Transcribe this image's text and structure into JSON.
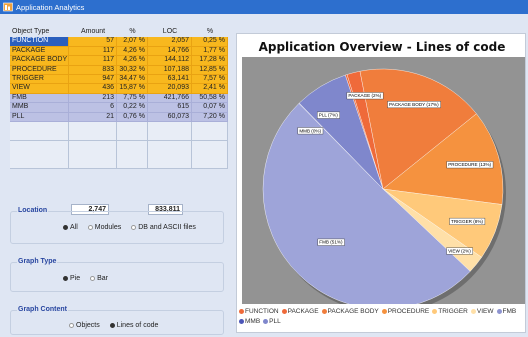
{
  "window": {
    "title": "Application Analytics"
  },
  "table": {
    "headers": [
      "Object Type",
      "Amount",
      "%",
      "LOC",
      "%"
    ],
    "rows": [
      {
        "type": "FUNCTION",
        "amount": "57",
        "pct": "2,07 %",
        "loc": "2,057",
        "loc_pct": "0,25 %",
        "group": "orange",
        "selected": true
      },
      {
        "type": "PACKAGE",
        "amount": "117",
        "pct": "4,26 %",
        "loc": "14,766",
        "loc_pct": "1,77 %",
        "group": "orange"
      },
      {
        "type": "PACKAGE BODY",
        "amount": "117",
        "pct": "4,26 %",
        "loc": "144,112",
        "loc_pct": "17,28 %",
        "group": "orange"
      },
      {
        "type": "PROCEDURE",
        "amount": "833",
        "pct": "30,32 %",
        "loc": "107,188",
        "loc_pct": "12,85 %",
        "group": "orange"
      },
      {
        "type": "TRIGGER",
        "amount": "947",
        "pct": "34,47 %",
        "loc": "63,141",
        "loc_pct": "7,57 %",
        "group": "orange"
      },
      {
        "type": "VIEW",
        "amount": "436",
        "pct": "15,87 %",
        "loc": "20,093",
        "loc_pct": "2,41 %",
        "group": "orange"
      },
      {
        "type": "FMB",
        "amount": "213",
        "pct": "7,75 %",
        "loc": "421,766",
        "loc_pct": "50,58 %",
        "group": "purple"
      },
      {
        "type": "MMB",
        "amount": "6",
        "pct": "0,22 %",
        "loc": "615",
        "loc_pct": "0,07 %",
        "group": "purple"
      },
      {
        "type": "PLL",
        "amount": "21",
        "pct": "0,76 %",
        "loc": "60,073",
        "loc_pct": "7,20 %",
        "group": "purple"
      }
    ],
    "total_amount": "2,747",
    "total_loc": "833,811"
  },
  "location": {
    "title": "Location",
    "options": [
      {
        "label": "All",
        "selected": true
      },
      {
        "label": "Modules",
        "selected": false
      },
      {
        "label": "DB and ASCII files",
        "selected": false
      }
    ]
  },
  "graph_type": {
    "title": "Graph Type",
    "options": [
      {
        "label": "Pie",
        "selected": true
      },
      {
        "label": "Bar",
        "selected": false
      }
    ]
  },
  "graph_content": {
    "title": "Graph Content",
    "options": [
      {
        "label": "Objects",
        "selected": false
      },
      {
        "label": "Lines of code",
        "selected": true
      }
    ]
  },
  "chart_data": {
    "type": "pie",
    "title": "Application Overview - Lines of code",
    "legend_position": "bottom",
    "slices": [
      {
        "name": "FUNCTION",
        "value": 0.25,
        "color": "#ef6a3a",
        "label": ""
      },
      {
        "name": "PACKAGE",
        "value": 1.77,
        "color": "#ef6a3a",
        "label": "PACKAGE (2%)"
      },
      {
        "name": "PACKAGE BODY",
        "value": 17.28,
        "color": "#f07d3c",
        "label": "PACKAGE BODY (17%)"
      },
      {
        "name": "PROCEDURE",
        "value": 12.85,
        "color": "#f5923f",
        "label": "PROCEDURE (13%)"
      },
      {
        "name": "TRIGGER",
        "value": 7.57,
        "color": "#ffc97a",
        "label": "TRIGGER (8%)"
      },
      {
        "name": "VIEW",
        "value": 2.41,
        "color": "#ffe0a8",
        "label": "VIEW (2%)"
      },
      {
        "name": "FMB",
        "value": 50.58,
        "color": "#9ea4d9",
        "label": "FMB (51%)"
      },
      {
        "name": "MMB",
        "value": 0.07,
        "color": "#6f78c6",
        "label": "MMB (0%)"
      },
      {
        "name": "PLL",
        "value": 7.2,
        "color": "#7f87cc",
        "label": "PLL (7%)"
      }
    ],
    "legend": [
      {
        "label": "FUNCTION",
        "color": "#ef6a3a"
      },
      {
        "label": "PACKAGE",
        "color": "#ef6a3a"
      },
      {
        "label": "PACKAGE BODY",
        "color": "#f07d3c"
      },
      {
        "label": "PROCEDURE",
        "color": "#f5923f"
      },
      {
        "label": "TRIGGER",
        "color": "#ffc97a"
      },
      {
        "label": "VIEW",
        "color": "#ffe0a8"
      },
      {
        "label": "FMB",
        "color": "#8d93cf"
      },
      {
        "label": "MMB",
        "color": "#4b55b7"
      },
      {
        "label": "PLL",
        "color": "#7f87cc"
      }
    ]
  }
}
